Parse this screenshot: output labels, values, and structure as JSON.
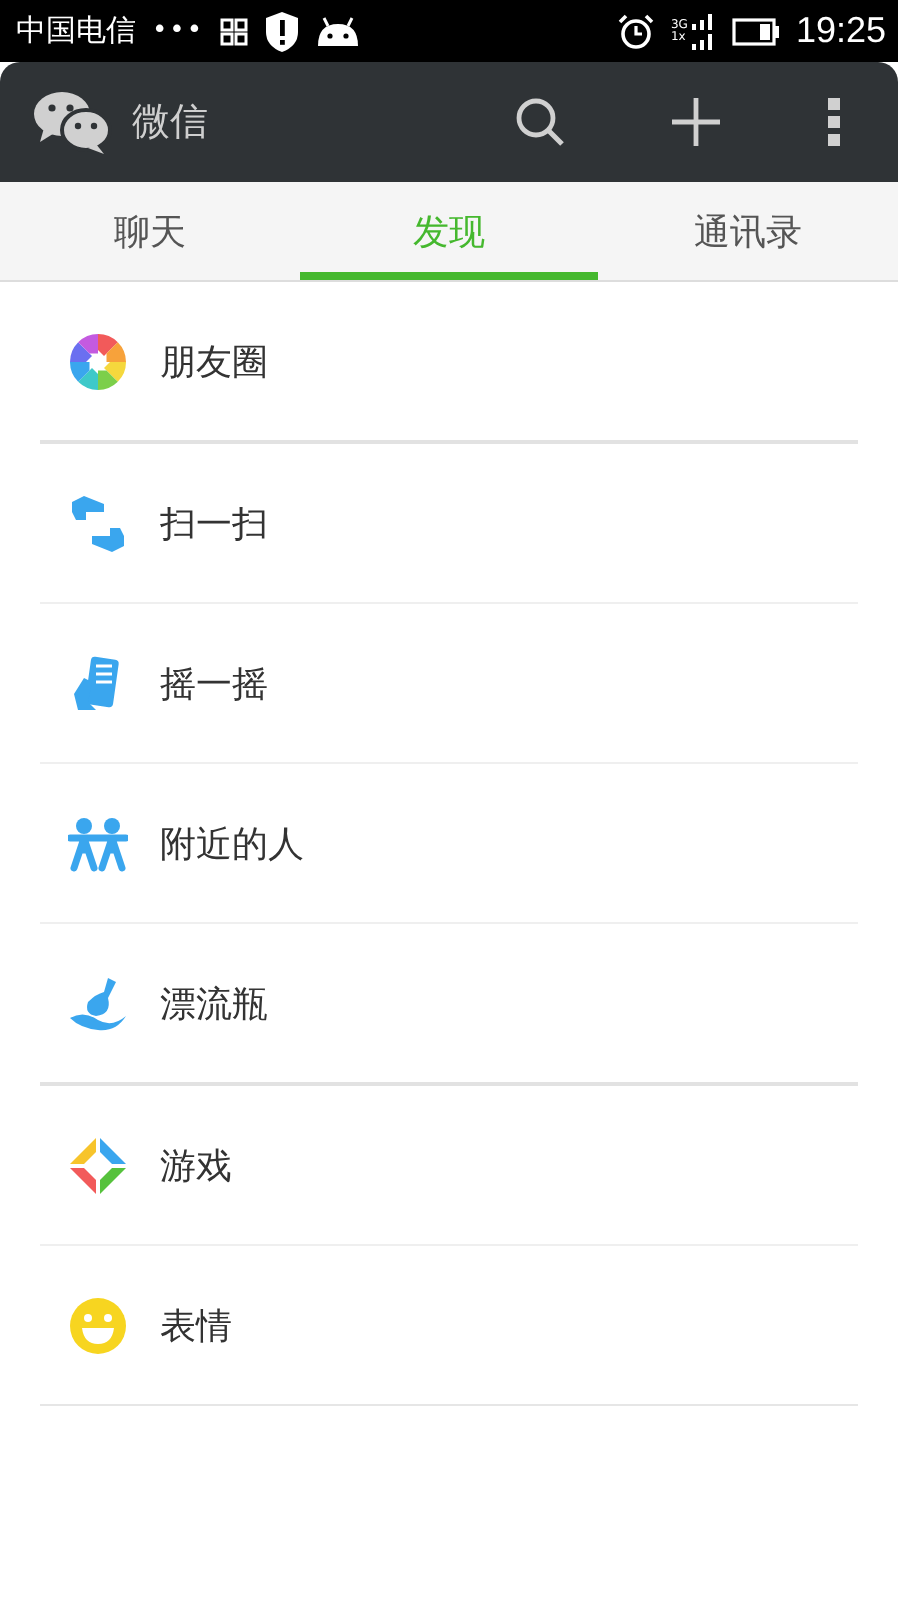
{
  "status_bar": {
    "carrier": "中国电信",
    "dots": "•••",
    "network_top": "3G",
    "network_bottom": "1x",
    "time": "19:25"
  },
  "header": {
    "title": "微信"
  },
  "tabs": [
    {
      "label": "聊天",
      "selected": false
    },
    {
      "label": "发现",
      "selected": true
    },
    {
      "label": "通讯录",
      "selected": false
    }
  ],
  "groups": [
    {
      "items": [
        {
          "label": "朋友圈",
          "kind": "moments"
        }
      ]
    },
    {
      "items": [
        {
          "label": "扫一扫",
          "kind": "scan"
        },
        {
          "label": "摇一摇",
          "kind": "shake"
        },
        {
          "label": "附近的人",
          "kind": "nearby"
        },
        {
          "label": "漂流瓶",
          "kind": "bottle"
        }
      ]
    },
    {
      "items": [
        {
          "label": "游戏",
          "kind": "games"
        },
        {
          "label": "表情",
          "kind": "emoji"
        }
      ]
    }
  ]
}
